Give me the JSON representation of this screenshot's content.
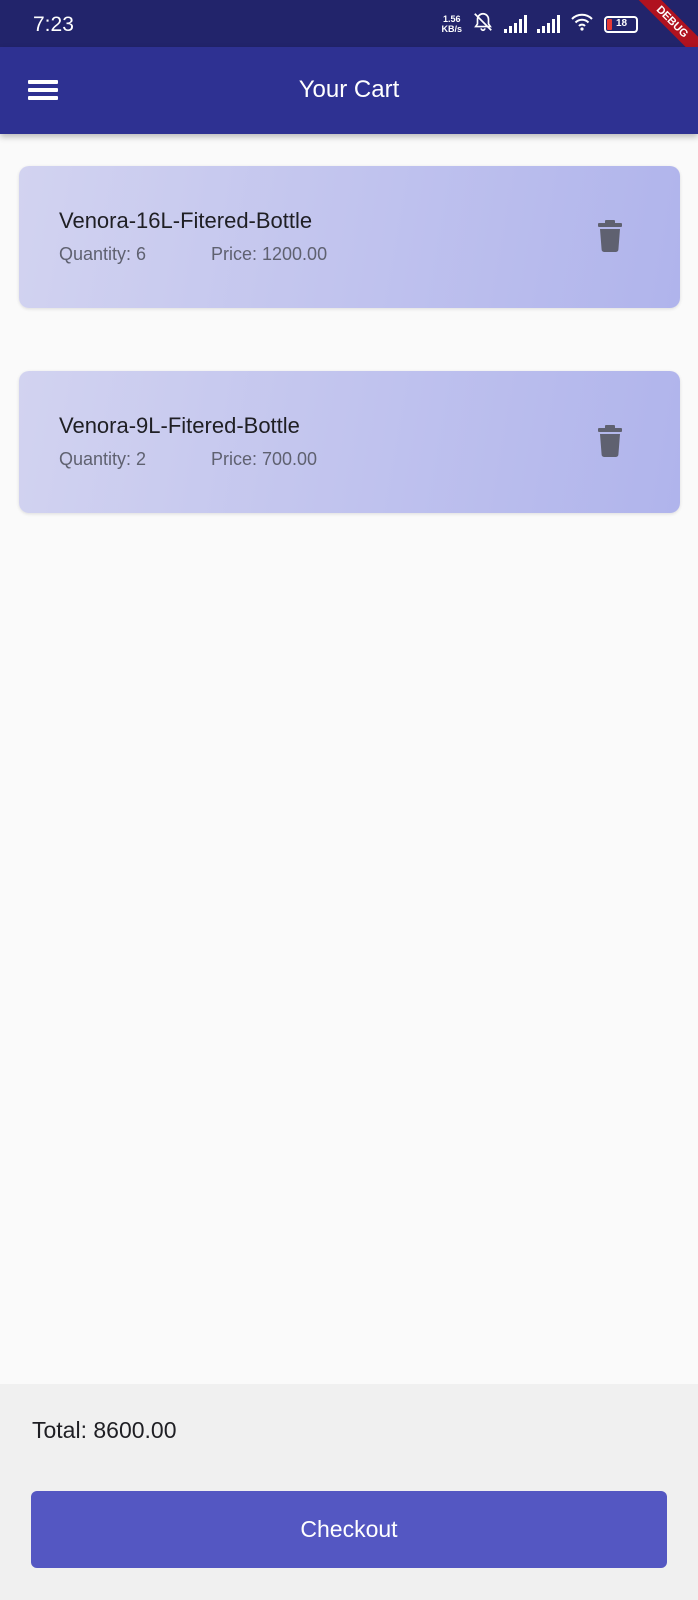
{
  "status_bar": {
    "time": "7:23",
    "net_speed_value": "1.56",
    "net_speed_unit": "KB/s",
    "battery": "18",
    "debug_label": "DEBUG"
  },
  "app_bar": {
    "title": "Your Cart",
    "menu_icon": "hamburger-menu-icon"
  },
  "cart": {
    "items": [
      {
        "name": "Venora-16L-Fitered-Bottle",
        "quantity_text": "Quantity: 6",
        "price_text": "Price: 1200.00",
        "delete_icon": "trash-icon"
      },
      {
        "name": "Venora-9L-Fitered-Bottle",
        "quantity_text": "Quantity: 2",
        "price_text": "Price: 700.00",
        "delete_icon": "trash-icon"
      }
    ]
  },
  "footer": {
    "total_text": "Total: 8600.00",
    "checkout_label": "Checkout"
  },
  "colors": {
    "status_bar": "#22246b",
    "app_bar": "#2e3192",
    "checkout_button": "#5457c2",
    "card_gradient_start": "#d2d3f0",
    "card_gradient_end": "#b0b4ec",
    "delete_icon": "#5f6170"
  }
}
